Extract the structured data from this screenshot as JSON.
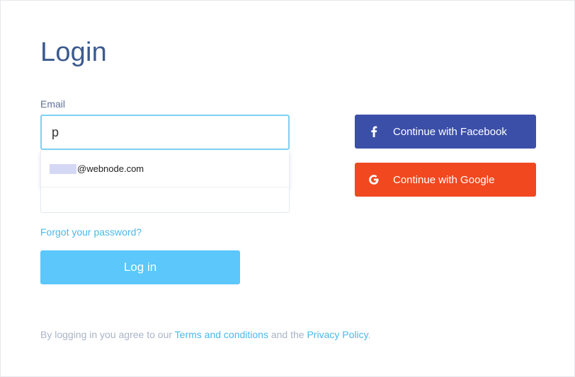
{
  "login": {
    "title": "Login",
    "email_label": "Email",
    "email_value": "p",
    "autocomplete_suffix": "@webnode.com",
    "password_value": "",
    "forgot_link": "Forgot your password?",
    "login_button": "Log in"
  },
  "social": {
    "facebook": {
      "label": "Continue with Facebook",
      "icon": "facebook-icon",
      "color": "#3b4fa9"
    },
    "google": {
      "label": "Continue with Google",
      "icon": "google-icon",
      "color": "#f1481f"
    }
  },
  "footer": {
    "prefix": "By logging in you agree to our ",
    "terms_link": "Terms and conditions",
    "middle": " and the ",
    "privacy_link": "Privacy Policy",
    "suffix": "."
  },
  "colors": {
    "title": "#3b5a8f",
    "accent": "#5bc7fb",
    "link": "#4ab8ea"
  }
}
